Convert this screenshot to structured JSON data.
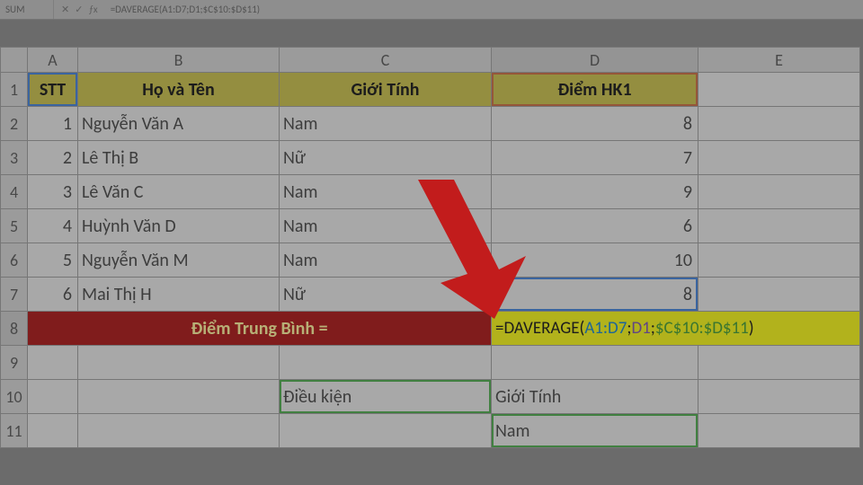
{
  "formula_bar": {
    "name_box": "SUM",
    "formula_text": "=DAVERAGE(A1:D7;D1;$C$10:$D$11)"
  },
  "columns": [
    "A",
    "B",
    "C",
    "D",
    "E"
  ],
  "rows": [
    "1",
    "2",
    "3",
    "4",
    "5",
    "6",
    "7",
    "8",
    "9",
    "10",
    "11"
  ],
  "headers": {
    "stt": "STT",
    "name": "Họ và Tên",
    "gender": "Giới Tính",
    "score": "Điểm HK1"
  },
  "data": [
    {
      "stt": "1",
      "name": "Nguyễn Văn A",
      "gender": "Nam",
      "score": "8"
    },
    {
      "stt": "2",
      "name": "Lê Thị B",
      "gender": "Nữ",
      "score": "7"
    },
    {
      "stt": "3",
      "name": "Lê Văn C",
      "gender": "Nam",
      "score": "9"
    },
    {
      "stt": "4",
      "name": "Huỳnh Văn D",
      "gender": "Nam",
      "score": "6"
    },
    {
      "stt": "5",
      "name": "Nguyễn Văn M",
      "gender": "Nam",
      "score": "10"
    },
    {
      "stt": "6",
      "name": "Mai Thị H",
      "gender": "Nữ",
      "score": "8"
    }
  ],
  "avg_label": "Điểm Trung Bình =",
  "formula": {
    "eq": "=",
    "fn": "DAVERAGE",
    "open": "(",
    "r1": "A1:D7",
    "sep": ";",
    "r2": "D1",
    "r3": "$C$10:$D$11",
    "close": ")"
  },
  "criteria": {
    "label": "Điều kiện",
    "field": "Giới Tính",
    "value": "Nam"
  }
}
